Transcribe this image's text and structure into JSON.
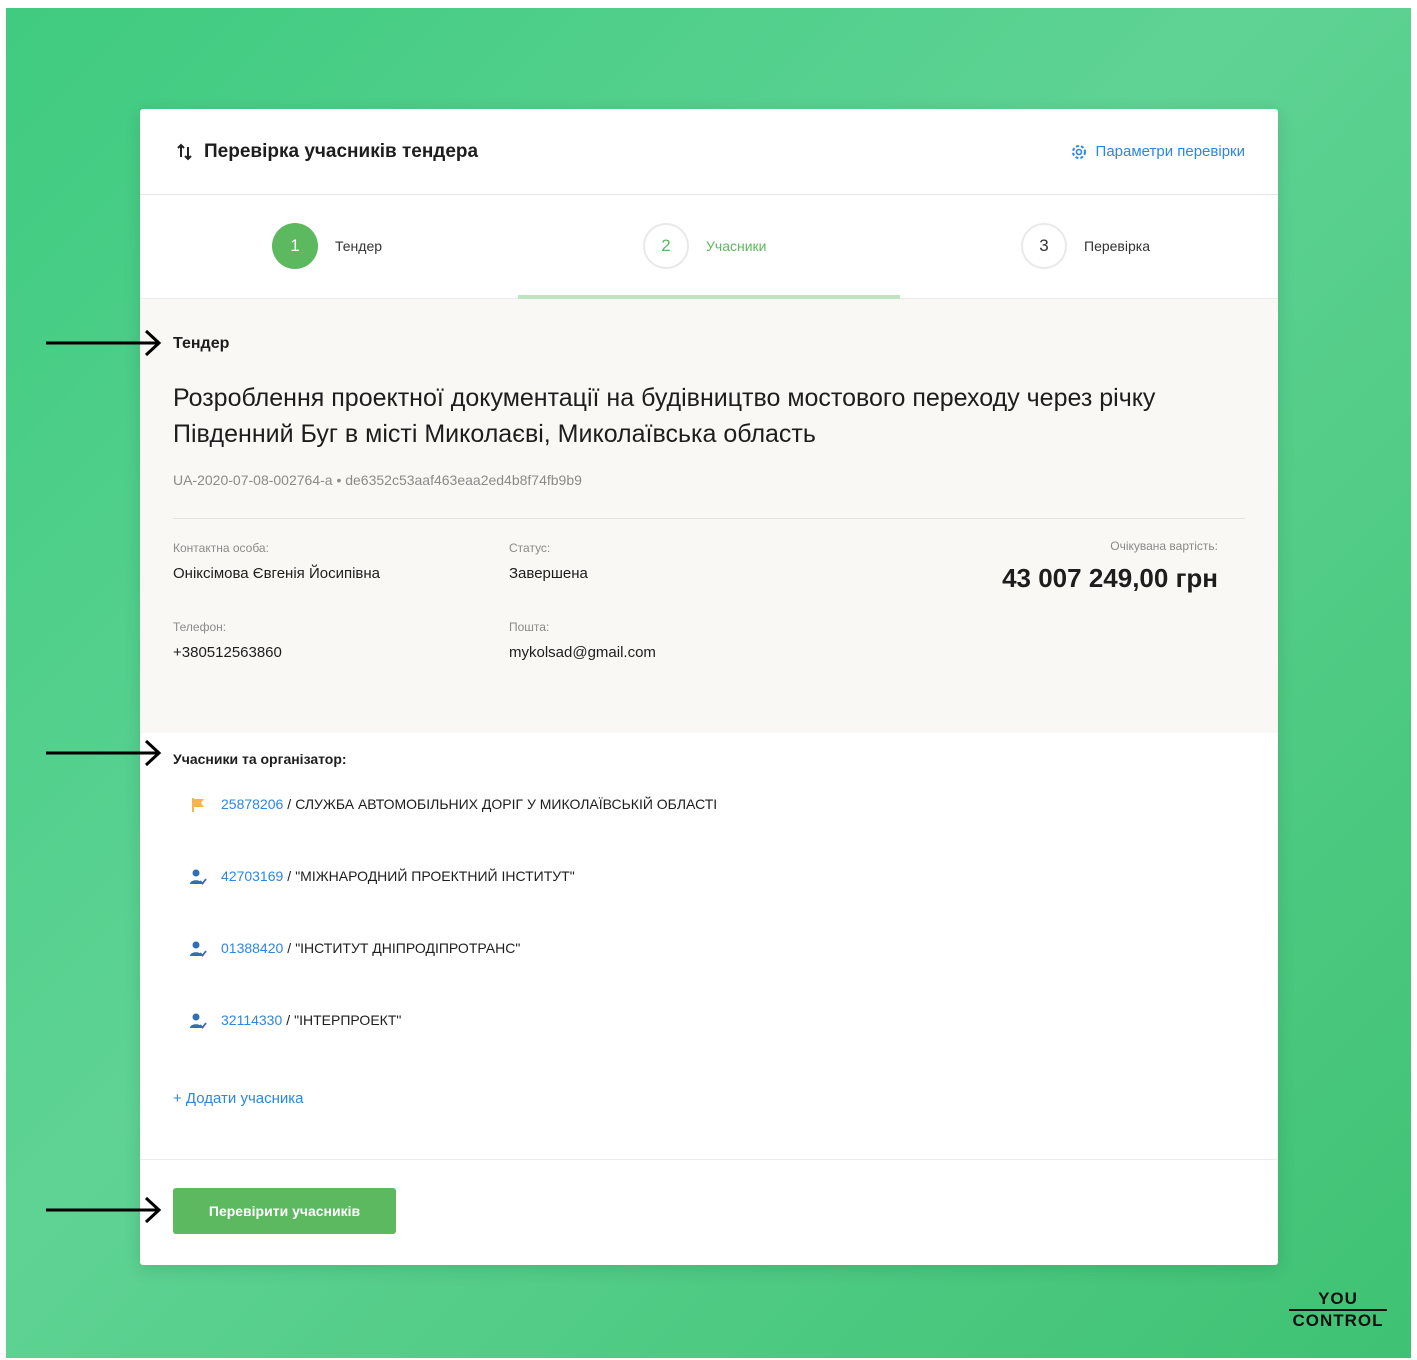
{
  "header": {
    "title": "Перевірка учасників тендера",
    "settings_label": "Параметри перевірки"
  },
  "steps": [
    {
      "number": "1",
      "label": "Тендер",
      "state": "done"
    },
    {
      "number": "2",
      "label": "Учасники",
      "state": "active"
    },
    {
      "number": "3",
      "label": "Перевірка",
      "state": "todo"
    }
  ],
  "tender": {
    "section_title": "Тендер",
    "name": "Розроблення проектної документації на будівництво мостового переходу через річку Південний Буг в місті Миколаєві, Миколаївська область",
    "id_line": "UA-2020-07-08-002764-a • de6352c53aaf463eaa2ed4b8f74fb9b9",
    "contact_label": "Контактна особа:",
    "contact_value": "Оніксімова Євгенія Йосипівна",
    "status_label": "Статус:",
    "status_value": "Завершена",
    "phone_label": "Телефон:",
    "phone_value": "+380512563860",
    "email_label": "Пошта:",
    "email_value": "mykolsad@gmail.com",
    "price_label": "Очікувана вартість:",
    "price_value": "43 007 249,00 грн"
  },
  "participants": {
    "section_title": "Учасники та організатор:",
    "items": [
      {
        "code": "25878206",
        "name": "СЛУЖБА АВТОМОБІЛЬНИХ ДОРІГ У МИКОЛАЇВСЬКІЙ ОБЛАСТІ",
        "icon": "flag-icon"
      },
      {
        "code": "42703169",
        "name": "\"МІЖНАРОДНИЙ ПРОЕКТНИЙ ІНСТИТУТ\"",
        "icon": "user-check-icon"
      },
      {
        "code": "01388420",
        "name": "\"ІНСТИТУТ ДНІПРОДІПРОТРАНС\"",
        "icon": "user-check-icon"
      },
      {
        "code": "32114330",
        "name": "\"ІНТЕРПРОЕКТ\"",
        "icon": "user-check-icon"
      }
    ],
    "separator": "/",
    "add_label": "+ Додати учасника"
  },
  "footer": {
    "check_button_label": "Перевірити учасників"
  },
  "logo": {
    "line1": "YOU",
    "line2": "CONTROL"
  },
  "colors": {
    "accent_green": "#5cb95f",
    "link_blue": "#2e86de",
    "flag_orange": "#f5b54a"
  }
}
